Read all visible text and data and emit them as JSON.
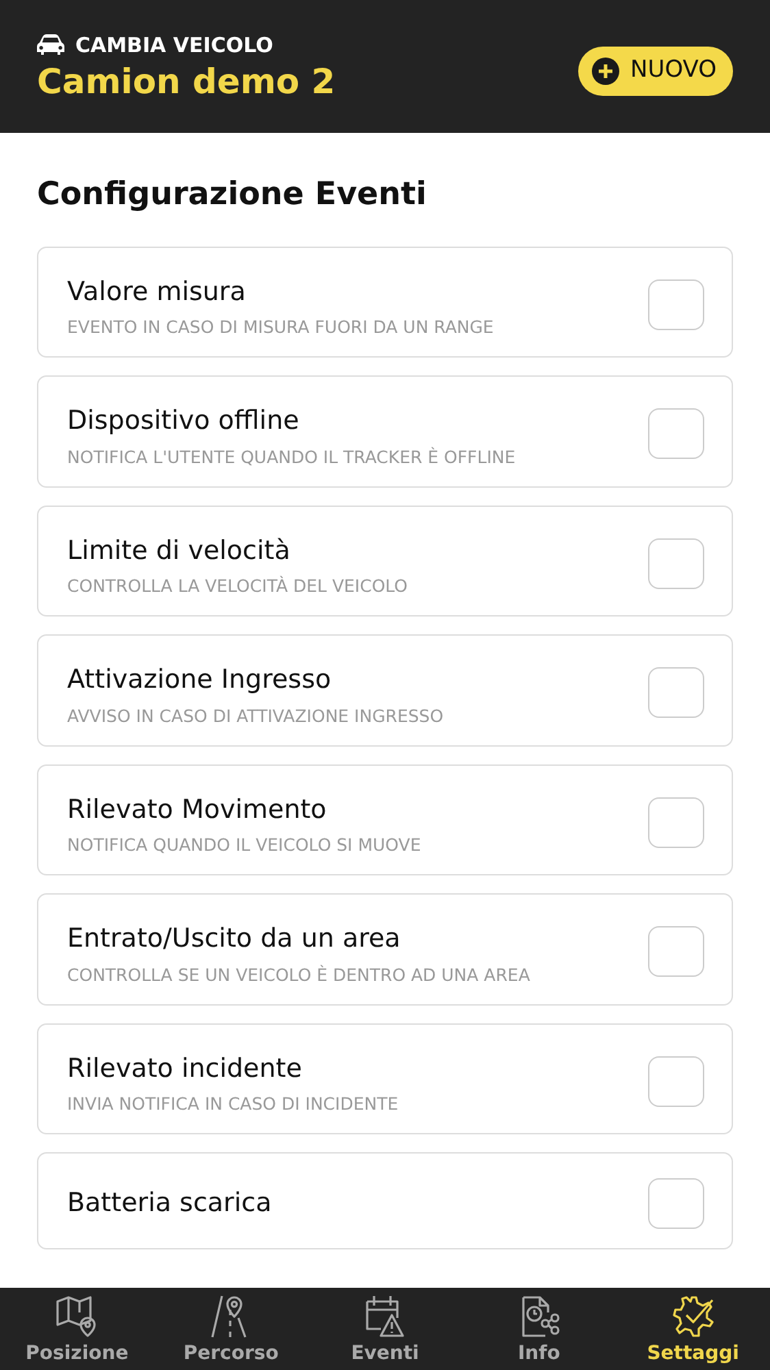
{
  "header": {
    "switch_label": "CAMBIA VEICOLO",
    "vehicle": "Camion demo 2",
    "new_button": "NUOVO"
  },
  "section_title": "Configurazione Eventi",
  "events": [
    {
      "title": "Valore misura",
      "description": "EVENTO IN CASO DI MISURA FUORI DA UN RANGE",
      "checked": false
    },
    {
      "title": "Dispositivo offline",
      "description": "NOTIFICA L'UTENTE QUANDO IL TRACKER È OFFLINE",
      "checked": false
    },
    {
      "title": "Limite di velocità",
      "description": "CONTROLLA LA VELOCITÀ DEL VEICOLO",
      "checked": false
    },
    {
      "title": "Attivazione Ingresso",
      "description": "AVVISO IN CASO DI ATTIVAZIONE INGRESSO",
      "checked": false
    },
    {
      "title": "Rilevato Movimento",
      "description": "NOTIFICA QUANDO IL VEICOLO SI MUOVE",
      "checked": false
    },
    {
      "title": "Entrato/Uscito da un area",
      "description": "CONTROLLA SE UN VEICOLO È DENTRO AD UNA AREA",
      "checked": false
    },
    {
      "title": "Rilevato incidente",
      "description": "INVIA NOTIFICA IN CASO DI INCIDENTE",
      "checked": false
    },
    {
      "title": "Batteria scarica",
      "checked": false
    }
  ],
  "tabs": [
    {
      "label": "Posizione",
      "kind": "map",
      "selected": false
    },
    {
      "label": "Percorso",
      "kind": "route",
      "selected": false
    },
    {
      "label": "Eventi",
      "kind": "calendar",
      "selected": false
    },
    {
      "label": "Info",
      "kind": "info",
      "selected": false
    },
    {
      "label": "Settaggi",
      "kind": "settings",
      "selected": true
    }
  ]
}
